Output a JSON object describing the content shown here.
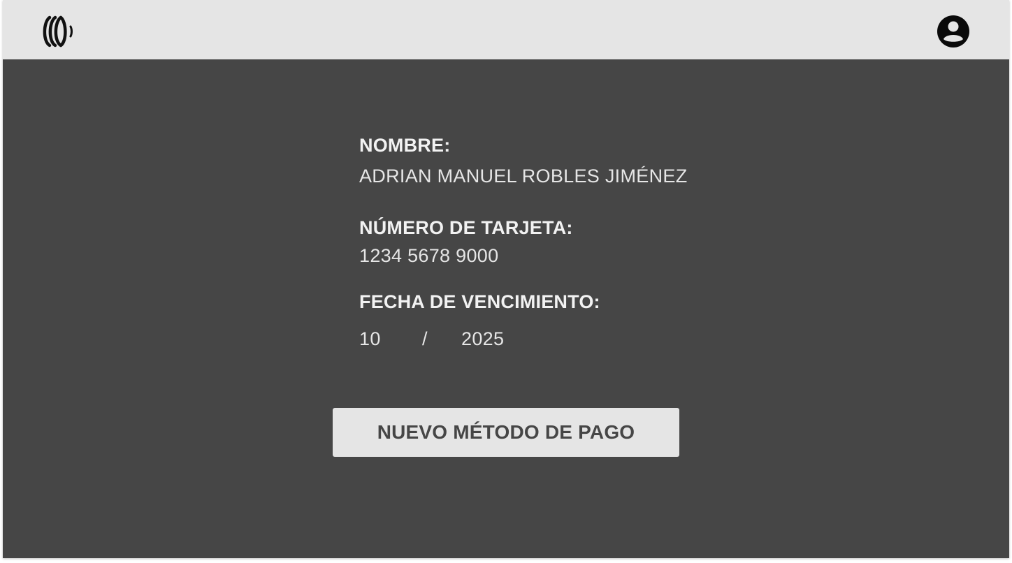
{
  "header": {
    "logo_icon": "sound-waves-logo-icon",
    "profile_icon": "user-circle-icon"
  },
  "payment": {
    "name_label": "NOMBRE:",
    "name_value": "ADRIAN MANUEL ROBLES JIMÉNEZ",
    "card_label": "NÚMERO DE TARJETA:",
    "card_value": "1234 5678 9000",
    "expiry_label": "FECHA DE VENCIMIENTO:",
    "expiry_month": "10",
    "expiry_separator": "/",
    "expiry_year": "2025"
  },
  "actions": {
    "new_method_label": "NUEVO MÉTODO DE PAGO"
  },
  "colors": {
    "background": "#464646",
    "topbar": "#e5e5e5",
    "button": "#e5e5e5",
    "text": "#f0f0f0"
  }
}
